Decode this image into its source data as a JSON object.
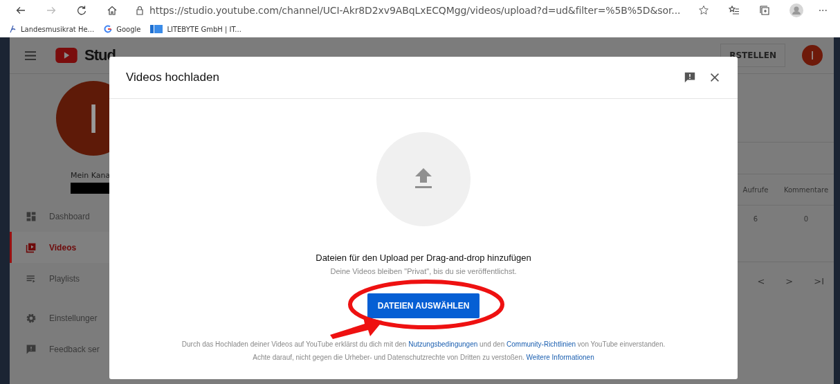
{
  "browser": {
    "url": "https://studio.youtube.com/channel/UCI-Akr8D2xv9ABqLxECQMgg/videos/upload?d=ud&filter=%5B%5D&sor...",
    "more": "···",
    "bookmarks": [
      {
        "label": "Landesmusikrat He...",
        "kind": "music"
      },
      {
        "label": "Google",
        "kind": "google"
      },
      {
        "label": "LITEBYTE GmbH | IT...",
        "kind": "site"
      }
    ]
  },
  "header": {
    "logo_text": "Stud",
    "create_button": "RSTELLEN",
    "avatar_letter": "I"
  },
  "sidebar": {
    "avatar_letter": "I",
    "channel_label": "Mein Kana",
    "items": [
      {
        "label": "Dashboard",
        "kind": "dashboard",
        "selected": false
      },
      {
        "label": "Videos",
        "kind": "videos",
        "selected": true
      },
      {
        "label": "Playlists",
        "kind": "playlists",
        "selected": false
      },
      {
        "label": "Einstellunger",
        "kind": "settings",
        "selected": false
      },
      {
        "label": "Feedback ser",
        "kind": "feedback",
        "selected": false
      }
    ]
  },
  "table": {
    "columns": [
      "Aufrufe",
      "Kommentare"
    ],
    "rows": [
      [
        "6",
        "0"
      ]
    ],
    "pagination": [
      "<",
      ">",
      ">I"
    ]
  },
  "dialog": {
    "title": "Videos hochladen",
    "prompt": "Dateien für den Upload per Drag-and-drop hinzufügen",
    "note": "Deine Videos bleiben \"Privat\", bis du sie veröffentlichst.",
    "button": "DATEIEN AUSWÄHLEN",
    "terms": [
      [
        {
          "text": "Durch das Hochladen deiner Videos auf YouTube erklärst du dich mit den ",
          "link": false
        },
        {
          "text": "Nutzungsbedingungen",
          "link": true
        },
        {
          "text": " und den ",
          "link": false
        },
        {
          "text": "Community-Richtlinien",
          "link": true
        },
        {
          "text": " von YouTube einverstanden.",
          "link": false
        }
      ],
      [
        {
          "text": "Achte darauf, nicht gegen die Urheber- und Datenschutzrechte von Dritten zu verstoßen. ",
          "link": false
        },
        {
          "text": "Weitere Informationen",
          "link": true
        }
      ]
    ]
  }
}
